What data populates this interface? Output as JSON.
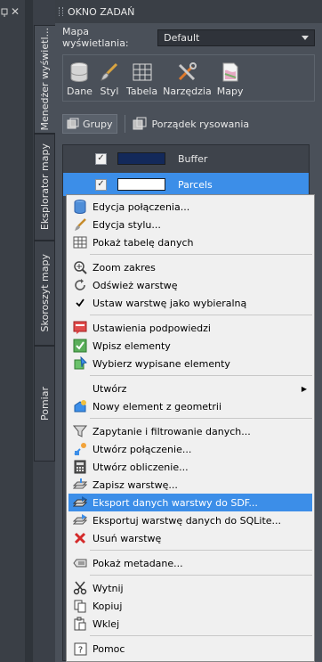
{
  "panel": {
    "title": "OKNO ZADAŃ",
    "map_label": "Mapa wyświetlania:",
    "map_value": "Default"
  },
  "side_tabs": [
    "Menedżer wyświetl...",
    "Eksplorator mapy",
    "Skoroszyt mapy",
    "Pomiar"
  ],
  "toolbar": {
    "items": [
      "Dane",
      "Styl",
      "Tabela",
      "Narzędzia",
      "Mapy"
    ]
  },
  "group_bar": {
    "groups_label": "Grupy",
    "draw_order_label": "Porządek rysowania"
  },
  "layers": [
    {
      "name": "Buffer",
      "checked": true,
      "swatch": "#13295a"
    },
    {
      "name": "Parcels",
      "checked": true,
      "swatch": "#ffffff"
    }
  ],
  "context_menu": {
    "items": [
      {
        "label": "Edycja połączenia...",
        "icon": "database-icon"
      },
      {
        "label": "Edycja stylu...",
        "icon": "brush-icon"
      },
      {
        "label": "Pokaż tabelę danych",
        "icon": "table-icon"
      },
      {
        "label": "Zoom zakres",
        "icon": "zoom-icon"
      },
      {
        "label": "Odśwież warstwę",
        "icon": "refresh-icon"
      },
      {
        "label": "Ustaw warstwę jako wybieralną",
        "icon": "checkmark-icon"
      },
      {
        "label": "Ustawienia podpowiedzi",
        "icon": "tooltip-settings-icon"
      },
      {
        "label": "Wpisz elementy",
        "icon": "check-features-icon"
      },
      {
        "label": "Wybierz wypisane elementy",
        "icon": "select-features-icon"
      },
      {
        "label": "Utwórz",
        "icon": "submenu-icon"
      },
      {
        "label": "Nowy element z geometrii",
        "icon": "new-feature-icon"
      },
      {
        "label": "Zapytanie i filtrowanie danych...",
        "icon": "filter-icon"
      },
      {
        "label": "Utwórz połączenie...",
        "icon": "create-join-icon"
      },
      {
        "label": "Utwórz obliczenie...",
        "icon": "calculator-icon"
      },
      {
        "label": "Zapisz warstwę...",
        "icon": "save-layer-icon"
      },
      {
        "label": "Eksport danych warstwy do SDF...",
        "icon": "export-sdf-icon"
      },
      {
        "label": "Eksportuj warstwę danych do SQLite...",
        "icon": "export-sqlite-icon"
      },
      {
        "label": "Usuń warstwę",
        "icon": "delete-icon"
      },
      {
        "label": "Pokaż metadane...",
        "icon": "metadata-icon"
      },
      {
        "label": "Wytnij",
        "icon": "scissors-icon"
      },
      {
        "label": "Kopiuj",
        "icon": "copy-icon"
      },
      {
        "label": "Wklej",
        "icon": "paste-icon"
      },
      {
        "label": "Pomoc",
        "icon": "help-icon"
      }
    ],
    "highlighted": "Eksport danych warstwy do SDF..."
  },
  "colors": {
    "panel_bg": "#4a5059",
    "selection": "#3c8ee8",
    "menu_bg": "#f0f0f0"
  }
}
